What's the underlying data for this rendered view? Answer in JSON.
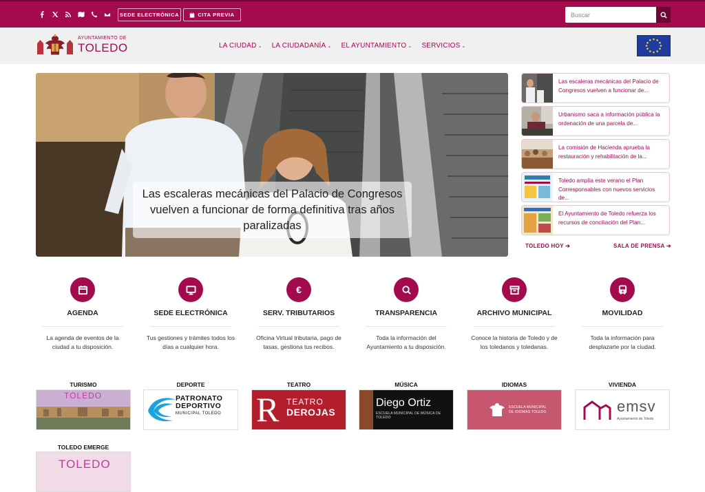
{
  "topbar": {
    "social_icons": [
      "facebook-icon",
      "x-icon",
      "rss-icon",
      "map-icon",
      "phone-icon",
      "mail-icon"
    ],
    "sede_label": "SEDE ELECTRÓNICA",
    "cita_label": "CITA PREVIA",
    "search_placeholder": "Buscar"
  },
  "header": {
    "logo_small": "AYUNTAMIENTO DE",
    "logo_big": "TOLEDO",
    "nav": [
      "LA CIUDAD",
      "LA CIUDADANÍA",
      "EL AYUNTAMIENTO",
      "SERVICIOS"
    ]
  },
  "hero": {
    "caption": "Las escaleras mecánicas del Palacio de Congresos vuelven a funcionar de forma definitiva tras años paralizadas"
  },
  "news": [
    {
      "text": "Las escaleras mecánicas del Palacio de Congresos vuelven a funcionar de..."
    },
    {
      "text": "Urbanismo saca a información pública la ordenación de una parcela de..."
    },
    {
      "text": "La comisión de Hacienda aprueba la restauración y rehabilitación de la..."
    },
    {
      "text": "Toledo amplía este verano el Plan Corresponsables con nuevos servicios de..."
    },
    {
      "text": "El Ayuntamiento de Toledo refuerza los recursos de conciliación del Plan..."
    }
  ],
  "links": {
    "toledo_hoy": "TOLEDO HOY",
    "sala_prensa": "SALA DE PRENSA"
  },
  "services": [
    {
      "title": "AGENDA",
      "desc": "La agenda de eventos de la ciudad a tu disposición.",
      "icon": "calendar-icon"
    },
    {
      "title": "SEDE ELECTRÓNICA",
      "desc": "Tus gestiones y trámites todos los días a cualquier hora.",
      "icon": "monitor-icon"
    },
    {
      "title": "SERV. TRIBUTARIOS",
      "desc": "Oficina Virtual tributaria, pago de tasas, gestiona tus recibos.",
      "icon": "euro-icon"
    },
    {
      "title": "TRANSPARENCIA",
      "desc": "Toda la información del Ayuntamiento a tu disposición.",
      "icon": "search-icon"
    },
    {
      "title": "ARCHIVO MUNICIPAL",
      "desc": "Conoce la historia de Toledo y de los toledanos y toledanas.",
      "icon": "archive-icon"
    },
    {
      "title": "MOVILIDAD",
      "desc": "Toda la información para desplazarte por la ciudad.",
      "icon": "bus-icon"
    }
  ],
  "tiles": [
    {
      "label": "TURISMO",
      "logo_text": "TOLEDO"
    },
    {
      "label": "DEPORTE",
      "logo_text": "PATRONATO",
      "logo_text2": "DEPORTIVO",
      "logo_text3": "MUNICIPAL TOLEDO"
    },
    {
      "label": "TEATRO",
      "logo_text": "TEATRO",
      "logo_text2": "DEROJAS"
    },
    {
      "label": "MÚSICA",
      "logo_text": "Diego Ortiz",
      "logo_text2": "ESCUELA MUNICIPAL DE MÚSICA DE TOLEDO"
    },
    {
      "label": "IDIOMAS",
      "logo_text": "ESCUELA MUNICIPAL DE IDIOMAS TOLEDO"
    },
    {
      "label": "VIVIENDA",
      "logo_text": "emsv",
      "logo_text2": "Ayuntamiento de Toledo"
    },
    {
      "label": "TOLEDO EMERGE",
      "logo_text": "TOLEDO"
    }
  ],
  "colors": {
    "brand": "#a30b4e",
    "brand_dark": "#6d0734"
  }
}
